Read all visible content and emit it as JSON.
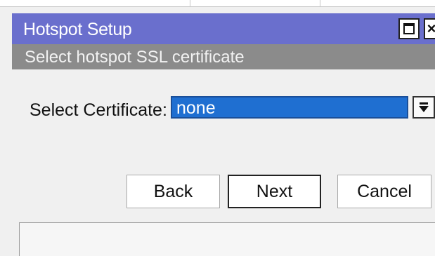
{
  "window": {
    "title": "Hotspot Setup",
    "maximize_icon": "maximize-icon",
    "close_icon": "close-icon"
  },
  "section": {
    "heading": "Select hotspot SSL certificate"
  },
  "form": {
    "certificate_label": "Select Certificate:",
    "certificate_value": "none",
    "dropdown_icon": "dropdown-arrow-icon"
  },
  "buttons": {
    "back": "Back",
    "next": "Next",
    "cancel": "Cancel"
  },
  "colors": {
    "titlebar": "#6a6fcd",
    "subheader": "#8b8b8b",
    "selection": "#1f6fd1"
  }
}
